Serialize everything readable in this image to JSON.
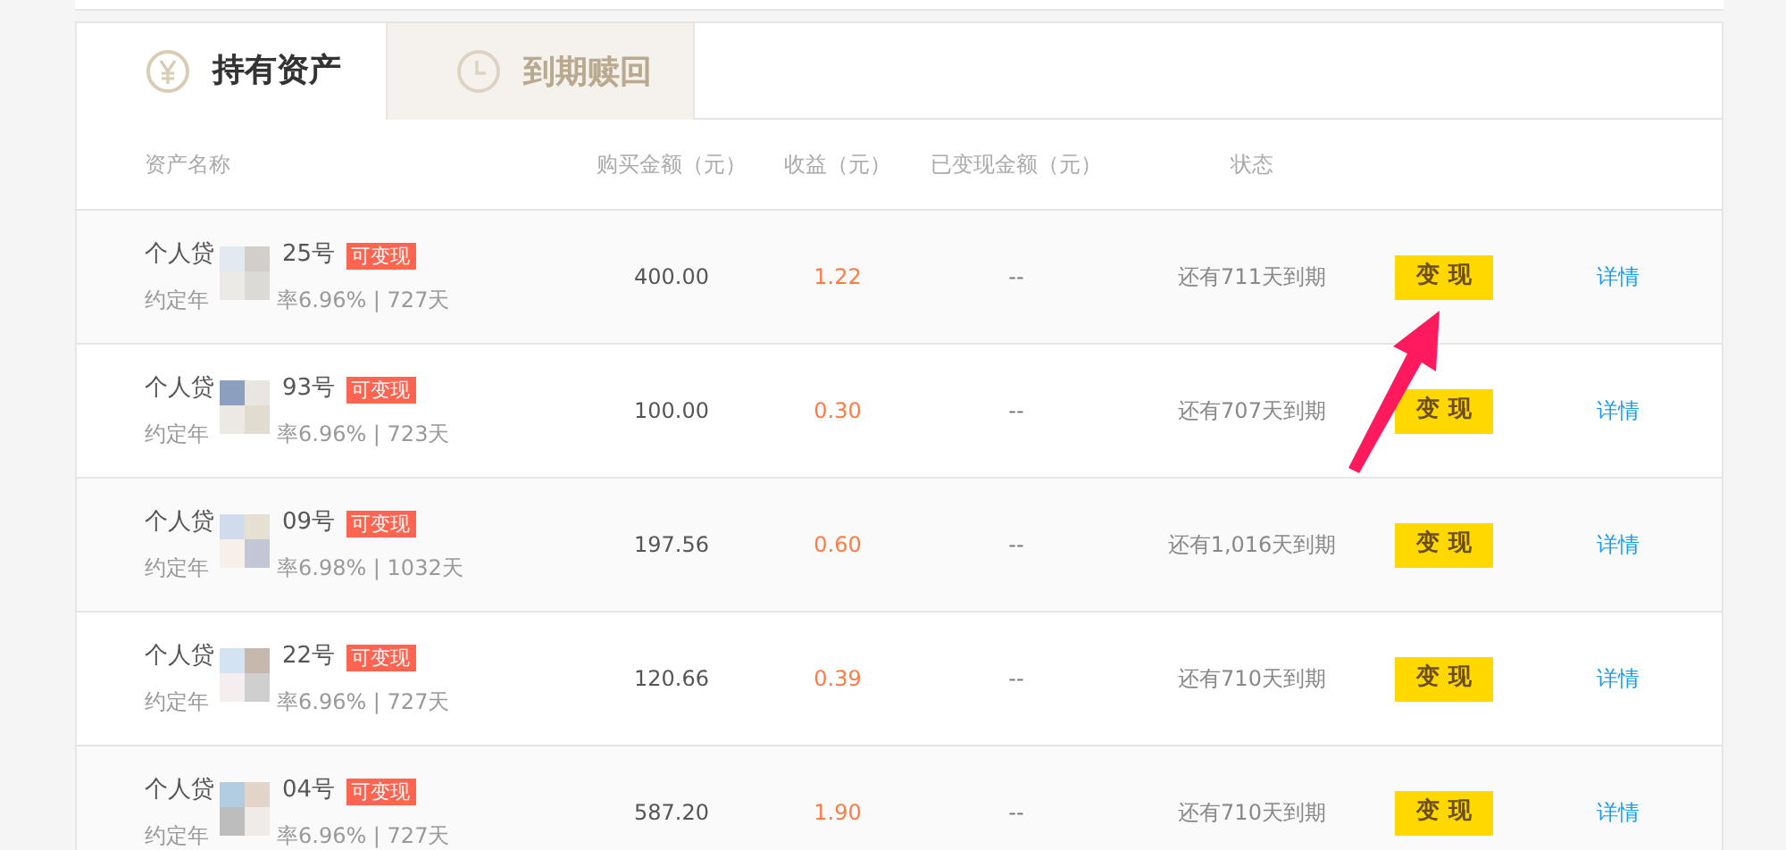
{
  "tabs": [
    {
      "label": "持有资产",
      "selected": true
    },
    {
      "label": "到期赎回",
      "selected": false
    }
  ],
  "table": {
    "columns": [
      "资产名称",
      "购买金额（元）",
      "收益（元）",
      "已变现金额（元）",
      "状态"
    ],
    "rows": [
      {
        "name_start": "个人贷",
        "name_end": "25号",
        "badge": "可变现",
        "rate_start": "约定年",
        "rate_end": "率6.96% | 727天",
        "amount": "400.00",
        "yield": "1.22",
        "realized": "--",
        "status": "还有711天到期",
        "action": "变 现",
        "details": "详情"
      },
      {
        "name_start": "个人贷",
        "name_end": "93号",
        "badge": "可变现",
        "rate_start": "约定年",
        "rate_end": "率6.96% | 723天",
        "amount": "100.00",
        "yield": "0.30",
        "realized": "--",
        "status": "还有707天到期",
        "action": "变 现",
        "details": "详情"
      },
      {
        "name_start": "个人贷",
        "name_end": "09号",
        "badge": "可变现",
        "rate_start": "约定年",
        "rate_end": "率6.98% | 1032天",
        "amount": "197.56",
        "yield": "0.60",
        "realized": "--",
        "status": "还有1,016天到期",
        "action": "变 现",
        "details": "详情"
      },
      {
        "name_start": "个人贷",
        "name_end": "22号",
        "badge": "可变现",
        "rate_start": "约定年",
        "rate_end": "率6.96% | 727天",
        "amount": "120.66",
        "yield": "0.39",
        "realized": "--",
        "status": "还有710天到期",
        "action": "变 现",
        "details": "详情"
      },
      {
        "name_start": "个人贷",
        "name_end": "04号",
        "badge": "可变现",
        "rate_start": "约定年",
        "rate_end": "率6.96% | 727天",
        "amount": "587.20",
        "yield": "1.90",
        "realized": "--",
        "status": "还有710天到期",
        "action": "变 现",
        "details": "详情"
      }
    ]
  }
}
